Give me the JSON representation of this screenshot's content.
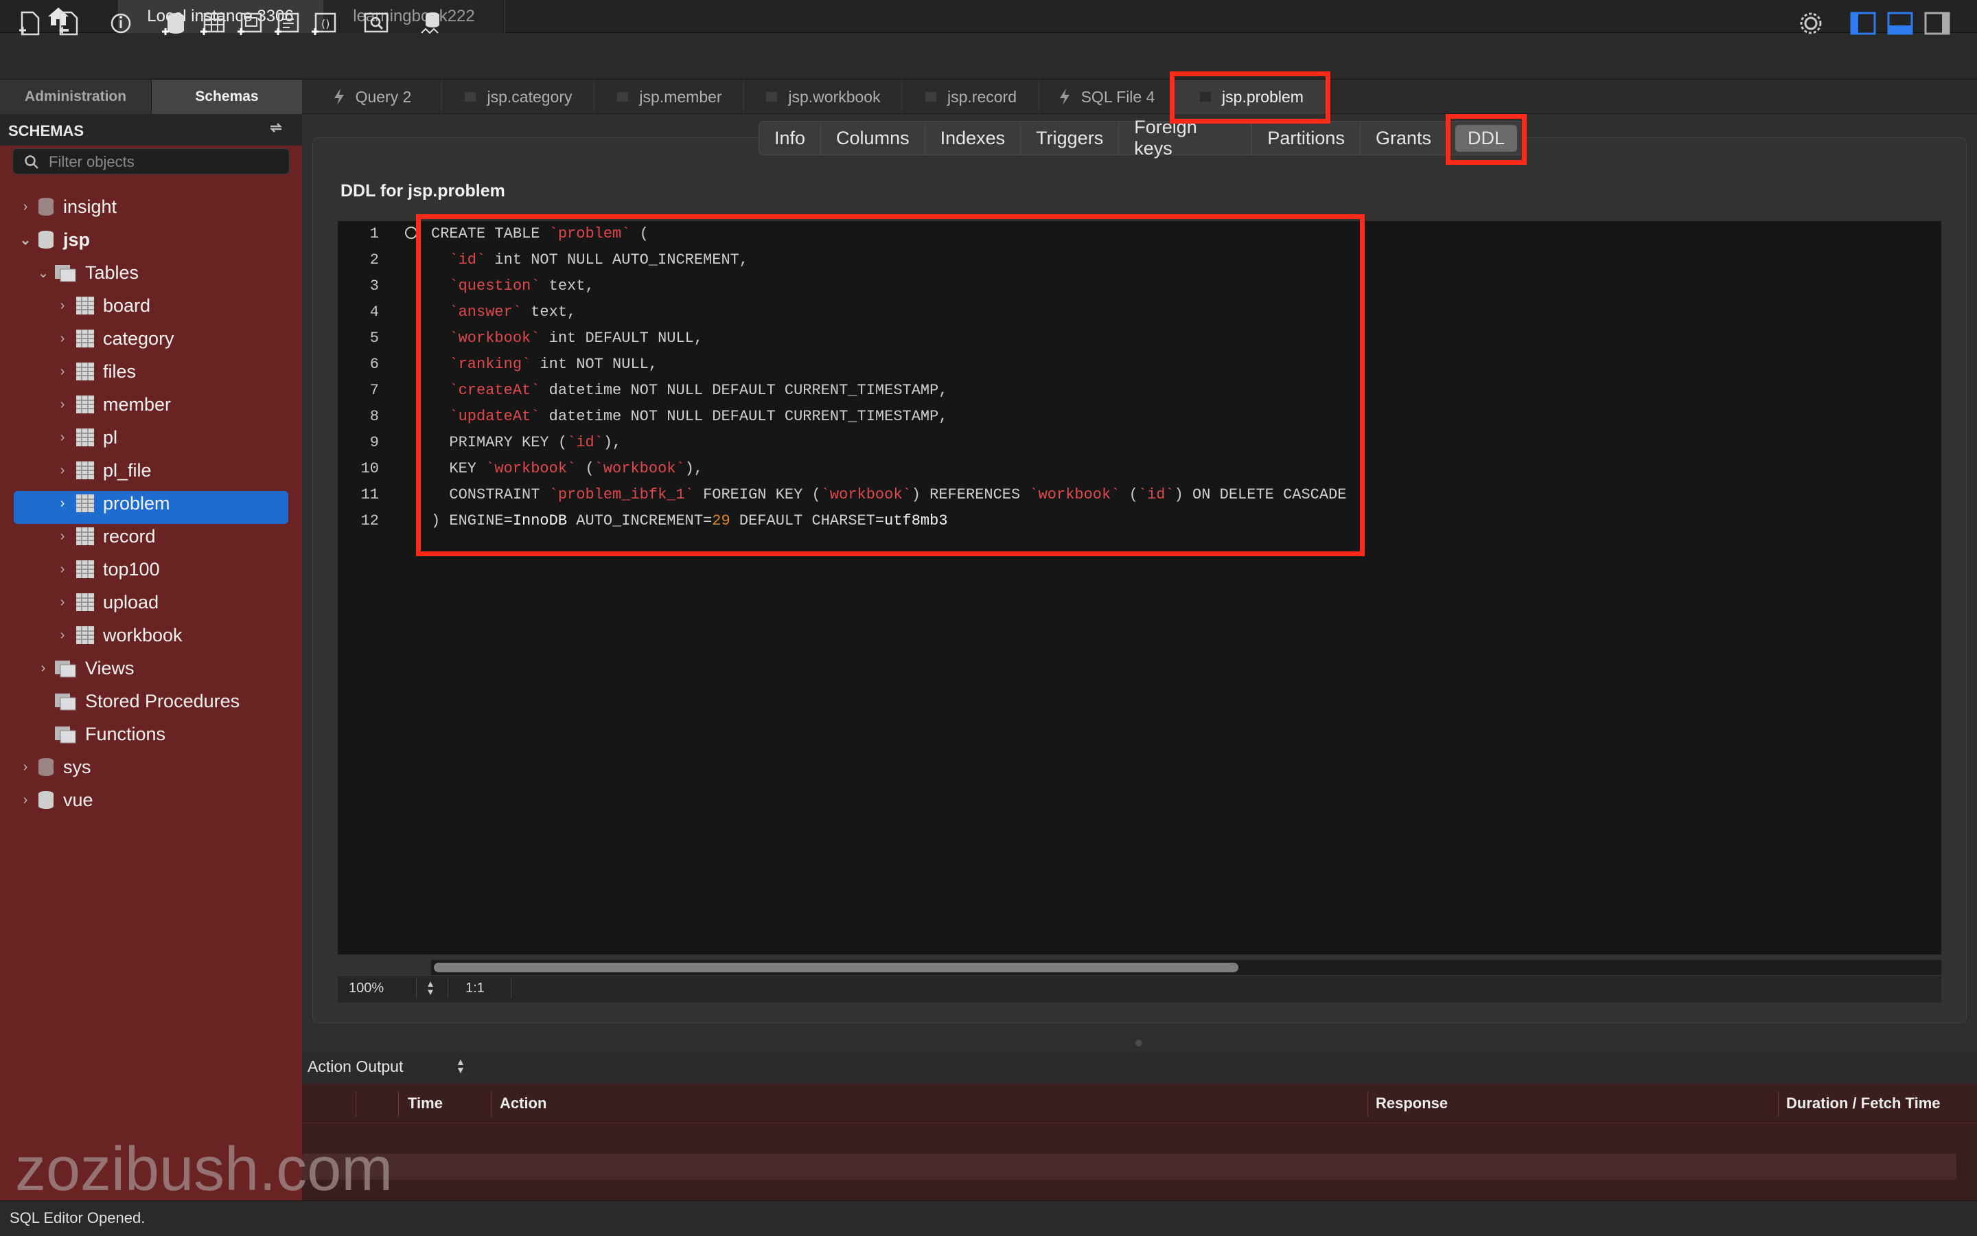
{
  "instance_tabs": [
    {
      "label": "Local instance 3306"
    },
    {
      "label": "learningbook222"
    }
  ],
  "sidebar": {
    "tabs": [
      "Administration",
      "Schemas"
    ],
    "header": "SCHEMAS",
    "filter_placeholder": "Filter objects",
    "tree": {
      "insight": "insight",
      "jsp": "jsp",
      "tables": "Tables",
      "table_items": [
        "board",
        "category",
        "files",
        "member",
        "pl",
        "pl_file",
        "problem",
        "record",
        "top100",
        "upload",
        "workbook"
      ],
      "views": "Views",
      "stored_procedures": "Stored Procedures",
      "functions": "Functions",
      "sys": "sys",
      "vue": "vue"
    }
  },
  "editor_tabs": [
    {
      "label": "Query 2",
      "icon": "lightning-icon"
    },
    {
      "label": "jsp.category",
      "icon": "table-icon"
    },
    {
      "label": "jsp.member",
      "icon": "table-icon"
    },
    {
      "label": "jsp.workbook",
      "icon": "table-icon"
    },
    {
      "label": "jsp.record",
      "icon": "table-icon"
    },
    {
      "label": "SQL File 4",
      "icon": "lightning-icon"
    },
    {
      "label": "jsp.problem",
      "icon": "table-icon"
    }
  ],
  "sub_tabs": [
    "Info",
    "Columns",
    "Indexes",
    "Triggers",
    "Foreign keys",
    "Partitions",
    "Grants",
    "DDL"
  ],
  "ddl": {
    "title": "DDL for jsp.problem",
    "line_numbers": [
      "1",
      "2",
      "3",
      "4",
      "5",
      "6",
      "7",
      "8",
      "9",
      "10",
      "11",
      "12"
    ],
    "code": {
      "l1a": "CREATE TABLE ",
      "l1b": "`problem`",
      "l1c": " (",
      "l2a": "  ",
      "l2b": "`id`",
      "l2c": " int NOT NULL AUTO_INCREMENT,",
      "l3a": "  ",
      "l3b": "`question`",
      "l3c": " text,",
      "l4a": "  ",
      "l4b": "`answer`",
      "l4c": " text,",
      "l5a": "  ",
      "l5b": "`workbook`",
      "l5c": " int DEFAULT NULL,",
      "l6a": "  ",
      "l6b": "`ranking`",
      "l6c": " int NOT NULL,",
      "l7a": "  ",
      "l7b": "`createAt`",
      "l7c": " datetime NOT NULL DEFAULT CURRENT_TIMESTAMP,",
      "l8a": "  ",
      "l8b": "`updateAt`",
      "l8c": " datetime NOT NULL DEFAULT CURRENT_TIMESTAMP,",
      "l9a": "  PRIMARY KEY (",
      "l9b": "`id`",
      "l9c": "),",
      "l10a": "  KEY ",
      "l10b": "`workbook`",
      "l10c": " (",
      "l10d": "`workbook`",
      "l10e": "),",
      "l11a": "  CONSTRAINT ",
      "l11b": "`problem_ibfk_1`",
      "l11c": " FOREIGN KEY (",
      "l11d": "`workbook`",
      "l11e": ") REFERENCES ",
      "l11f": "`workbook`",
      "l11g": " (",
      "l11h": "`id`",
      "l11i": ") ON DELETE CASCADE",
      "l12a": ") ENGINE=",
      "l12b": "InnoDB",
      "l12c": " AUTO_INCREMENT=",
      "l12d": "29",
      "l12e": " DEFAULT CHARSET=",
      "l12f": "utf8mb3"
    }
  },
  "editor_status": {
    "zoom": "100%",
    "cursor": "1:1"
  },
  "output": {
    "selector": "Action Output",
    "columns": [
      "Time",
      "Action",
      "Response",
      "Duration / Fetch Time"
    ]
  },
  "status_bar": "SQL Editor Opened.",
  "watermark": "zozibush.com",
  "colors": {
    "accent": "#1e6cd0",
    "highlight": "#ff2a1a",
    "sidebar": "#6a2323",
    "sql_identifier": "#e0484c"
  }
}
